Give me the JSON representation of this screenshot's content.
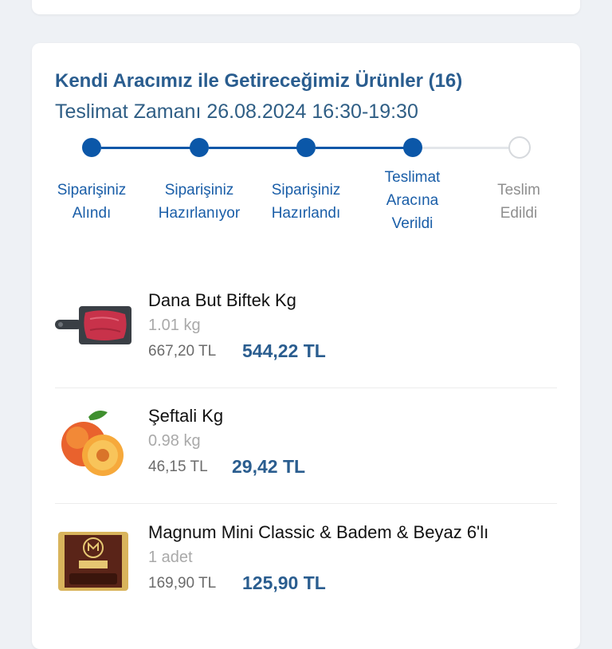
{
  "order": {
    "title": "Kendi Aracımız ile Getireceğimiz Ürünler (16)",
    "delivery_time": "Teslimat Zamanı 26.08.2024 16:30-19:30"
  },
  "tracker": {
    "accent": "#0b57a8",
    "steps": [
      {
        "label": "Siparişiniz Alındı",
        "done": true
      },
      {
        "label": "Siparişiniz Hazırlanıyor",
        "done": true
      },
      {
        "label": "Siparişiniz Hazırlandı",
        "done": true
      },
      {
        "label": "Teslimat Aracına Verildi",
        "done": true
      },
      {
        "label": "Teslim Edildi",
        "done": false
      }
    ]
  },
  "products": [
    {
      "name": "Dana But Biftek Kg",
      "qty": "1.01 kg",
      "old_price": "667,20 TL",
      "new_price": "544,22 TL",
      "icon": "beef-steak-image"
    },
    {
      "name": "Şeftali  Kg",
      "qty": "0.98 kg",
      "old_price": "46,15 TL",
      "new_price": "29,42 TL",
      "icon": "peach-image"
    },
    {
      "name": "Magnum Mini Classic & Badem & Beyaz 6'lı",
      "qty": "1 adet",
      "old_price": "169,90 TL",
      "new_price": "125,90 TL",
      "icon": "magnum-box-image"
    }
  ]
}
